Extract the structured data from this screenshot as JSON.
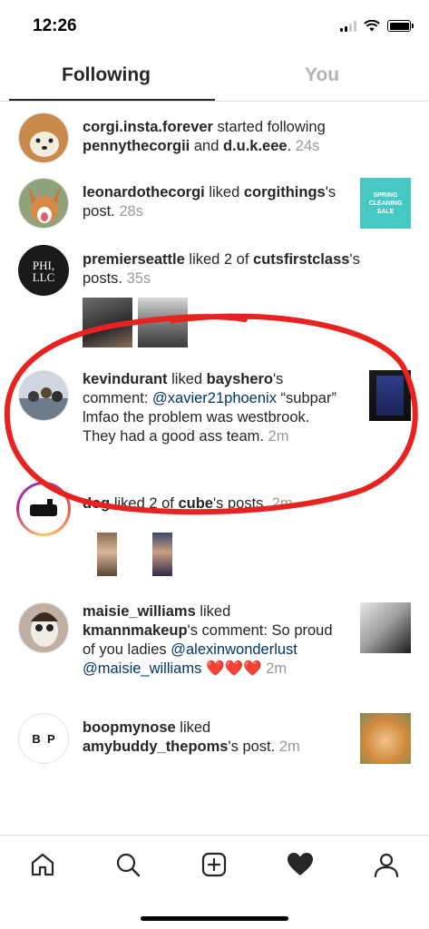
{
  "status_bar": {
    "time": "12:26"
  },
  "tabs": {
    "following": "Following",
    "you": "You"
  },
  "feed": [
    {
      "parts": [
        {
          "text": "corgi.insta.forever",
          "style": "b"
        },
        {
          "text": " started following ",
          "style": ""
        },
        {
          "text": "pennythecorgii",
          "style": "b"
        },
        {
          "text": " and ",
          "style": ""
        },
        {
          "text": "d.u.k.eee",
          "style": "b"
        },
        {
          "text": ". ",
          "style": ""
        },
        {
          "text": "24s",
          "style": "t"
        }
      ]
    },
    {
      "parts": [
        {
          "text": "leonardothecorgi",
          "style": "b"
        },
        {
          "text": " liked ",
          "style": ""
        },
        {
          "text": "corgithings",
          "style": "b"
        },
        {
          "text": "'s post. ",
          "style": ""
        },
        {
          "text": "28s",
          "style": "t"
        }
      ],
      "thumb_text": "SPRING CLEANING SALE"
    },
    {
      "parts": [
        {
          "text": "premierseattle",
          "style": "b"
        },
        {
          "text": " liked 2 of ",
          "style": ""
        },
        {
          "text": "cutsfirstclass",
          "style": "b"
        },
        {
          "text": "'s posts. ",
          "style": ""
        },
        {
          "text": "35s",
          "style": "t"
        }
      ],
      "avatar_text": "PHI, LLC"
    },
    {
      "parts": [
        {
          "text": "kevindurant",
          "style": "b"
        },
        {
          "text": " liked ",
          "style": ""
        },
        {
          "text": "bayshero",
          "style": "b"
        },
        {
          "text": "'s comment: ",
          "style": ""
        },
        {
          "text": "@xavier21phoenix",
          "style": "mention"
        },
        {
          "text": " “subpar” lmfao the problem was westbrook. They had a good ass team. ",
          "style": ""
        },
        {
          "text": "2m",
          "style": "t"
        }
      ]
    },
    {
      "parts": [
        {
          "text": "dog",
          "style": "b"
        },
        {
          "text": " liked 2 of ",
          "style": ""
        },
        {
          "text": "cube",
          "style": "b"
        },
        {
          "text": "'s posts. ",
          "style": ""
        },
        {
          "text": "2m",
          "style": "t"
        }
      ]
    },
    {
      "parts": [
        {
          "text": "maisie_williams",
          "style": "b"
        },
        {
          "text": " liked ",
          "style": ""
        },
        {
          "text": "kmannmakeup",
          "style": "b"
        },
        {
          "text": "'s comment: So proud of you ladies ",
          "style": ""
        },
        {
          "text": "@alexinwonderlust",
          "style": "mention"
        },
        {
          "text": " ",
          "style": ""
        },
        {
          "text": "@maisie_williams",
          "style": "mention"
        },
        {
          "text": " ❤️❤️❤️ ",
          "style": "heart"
        },
        {
          "text": "2m",
          "style": "t"
        }
      ]
    },
    {
      "parts": [
        {
          "text": "boopmynose",
          "style": "b"
        },
        {
          "text": " liked ",
          "style": ""
        },
        {
          "text": "amybuddy_thepoms",
          "style": "b"
        },
        {
          "text": "'s post. ",
          "style": ""
        },
        {
          "text": "2m",
          "style": "t"
        }
      ],
      "avatar_text": "B  P"
    }
  ],
  "colors": {
    "text": "#262626",
    "muted": "#999999",
    "mention": "#003569",
    "annotation": "#e8231f"
  },
  "icons": [
    "home-icon",
    "search-icon",
    "new-post-icon",
    "activity-heart-icon",
    "profile-icon"
  ]
}
